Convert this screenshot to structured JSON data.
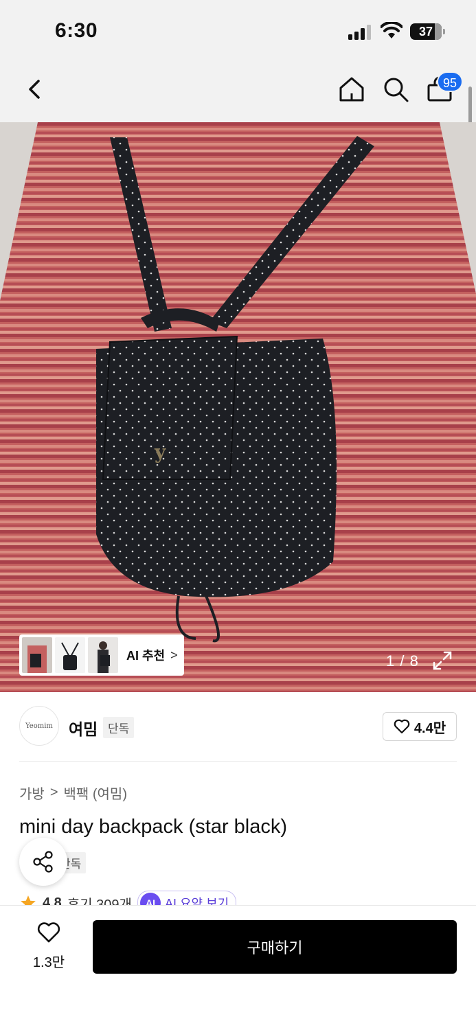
{
  "status_bar": {
    "time": "6:30",
    "battery": "37"
  },
  "nav": {
    "cart_count": "95",
    "icons": [
      "chevron-left-icon",
      "home-icon",
      "search-icon",
      "shopping-bag-icon"
    ]
  },
  "gallery": {
    "ai_recommend_label": "AI 추천",
    "ai_recommend_chevron": ">",
    "pager": "1 / 8"
  },
  "brand": {
    "logo_text": "Yeomim",
    "name": "여밈",
    "exclusive_tag": "단독",
    "likes": "4.4만"
  },
  "breadcrumb": {
    "category": "가방",
    "separator": ">",
    "subcategory": "백팩 (여밈)"
  },
  "product": {
    "title": "mini day backpack (star black)",
    "exclusive_tag": "단독"
  },
  "rating": {
    "score": "4.8",
    "reviews": "후기 309개",
    "ai_badge": "AI",
    "ai_summary": "AI 요약 보기"
  },
  "bottom_bar": {
    "wishlist_count": "1.3만",
    "buy_label": "구매하기"
  },
  "colors": {
    "accent_blue": "#1a6cf0",
    "ai_purple": "#6a4df0",
    "star": "#f5a623"
  }
}
